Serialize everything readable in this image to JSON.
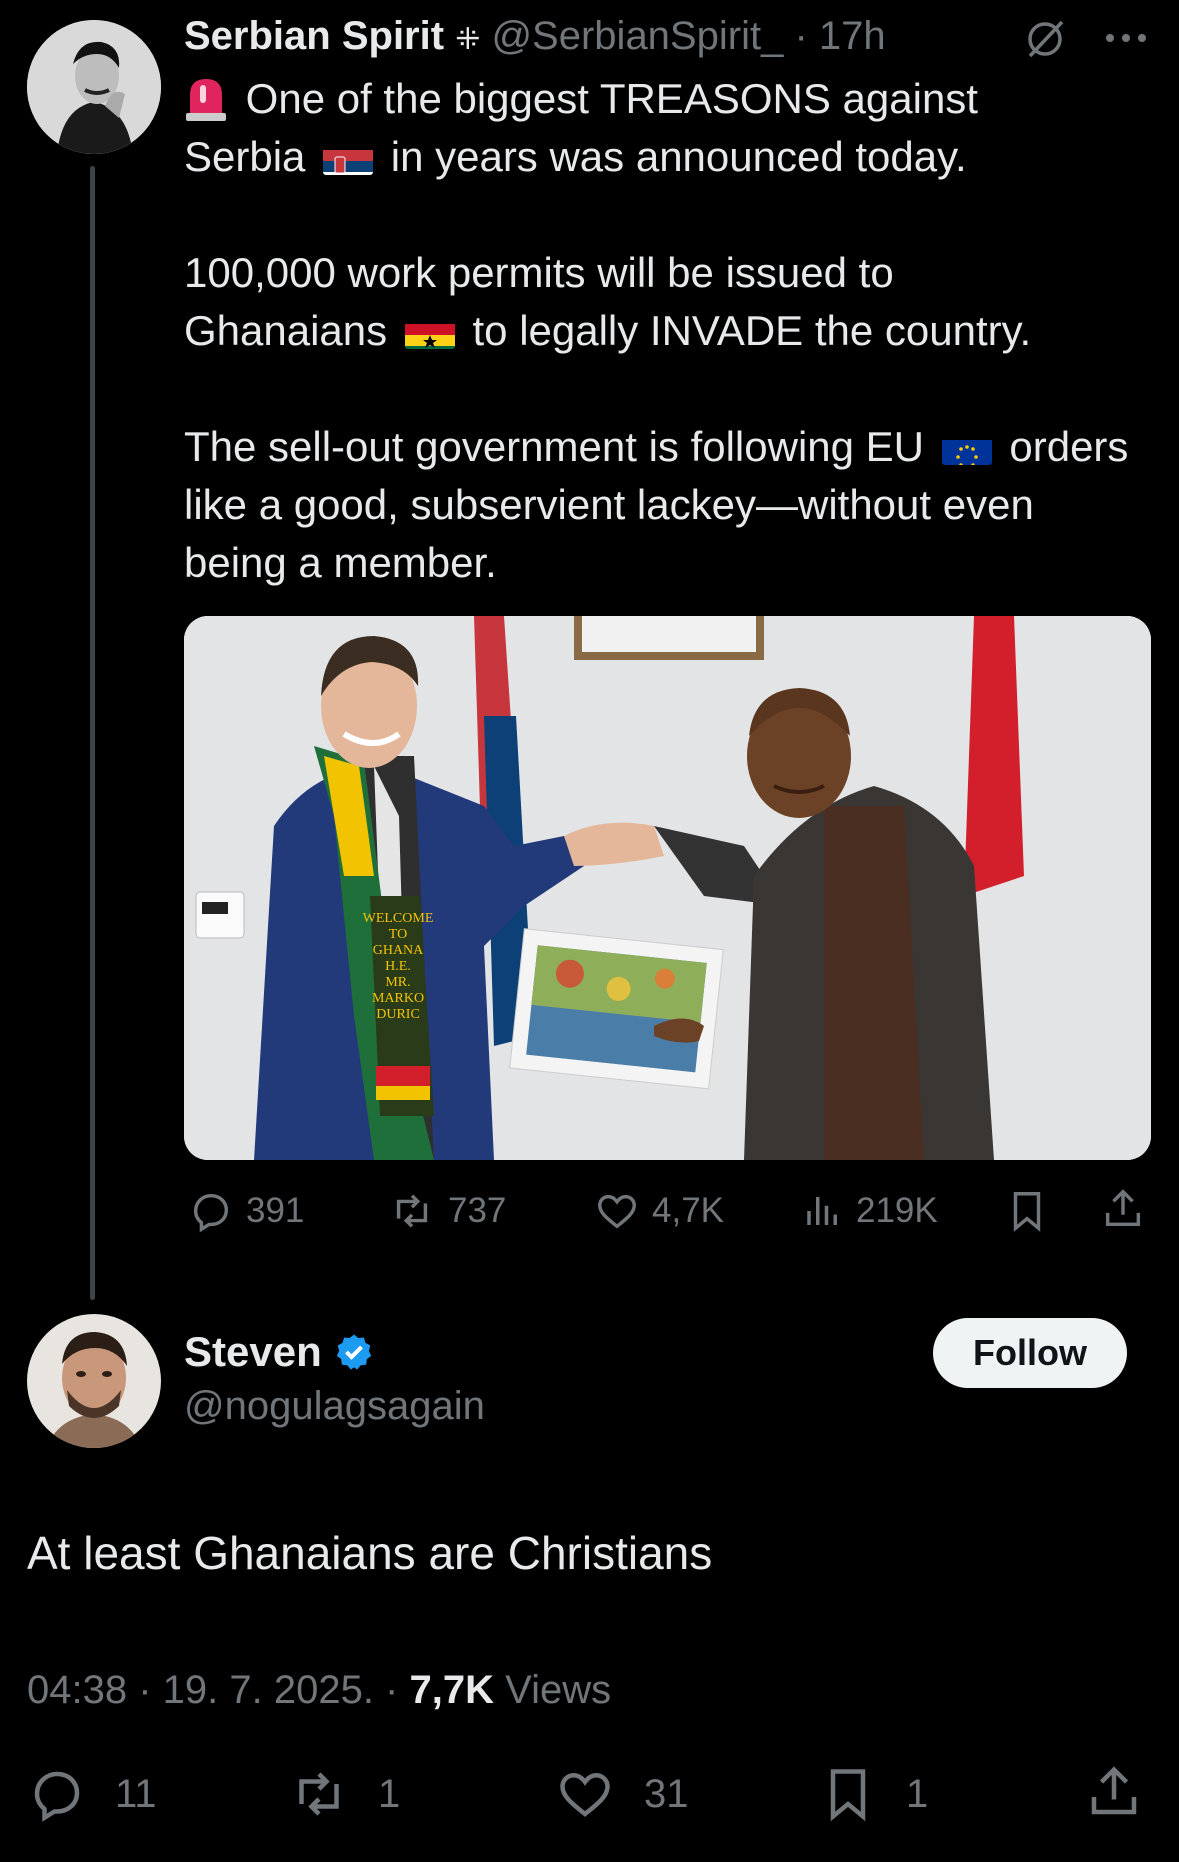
{
  "parent_tweet": {
    "author_name": "Serbian Spirit",
    "author_badge_glyph": "⁜",
    "handle": "@SerbianSpirit_",
    "separator": "·",
    "time": "17h",
    "text_line1_a": "One of the biggest TREASONS against",
    "text_line2_a": "Serbia",
    "text_line2_b": "in years was announced today.",
    "text_p2_a": "100,000 work permits will be issued to",
    "text_p2_b": "Ghanaians",
    "text_p2_c": "to legally INVADE the country.",
    "text_p3_a": "The sell-out government is following EU",
    "text_p3_b": "orders like a good, subservient lackey—without even being a member.",
    "image_caption_sash": [
      "WELCOME",
      "TO",
      "GHANA",
      "H.E.",
      "MR.",
      "MARKO",
      "DURIC"
    ],
    "stats": {
      "replies": "391",
      "reposts": "737",
      "likes": "4,7K",
      "views": "219K"
    }
  },
  "reply_tweet": {
    "author_name": "Steven",
    "handle": "@nogulagsagain",
    "follow_label": "Follow",
    "text": "At least Ghanaians are Christians",
    "timestamp": "04:38 · 19. 7. 2025. ·",
    "views_count": "7,7K",
    "views_label": "Views",
    "stats": {
      "replies": "11",
      "reposts": "1",
      "likes": "31",
      "bookmarks": "1"
    }
  },
  "icons": [
    "grok-icon",
    "more-icon",
    "siren-emoji",
    "serbia-flag",
    "ghana-flag",
    "eu-flag",
    "reply-icon",
    "repost-icon",
    "like-icon",
    "views-icon",
    "bookmark-icon",
    "share-icon",
    "verified-icon"
  ],
  "colors": {
    "background": "#000000",
    "text": "#e7e9ea",
    "muted": "#71767b",
    "verified": "#1d9bf0",
    "follow_bg": "#eff3f4"
  }
}
